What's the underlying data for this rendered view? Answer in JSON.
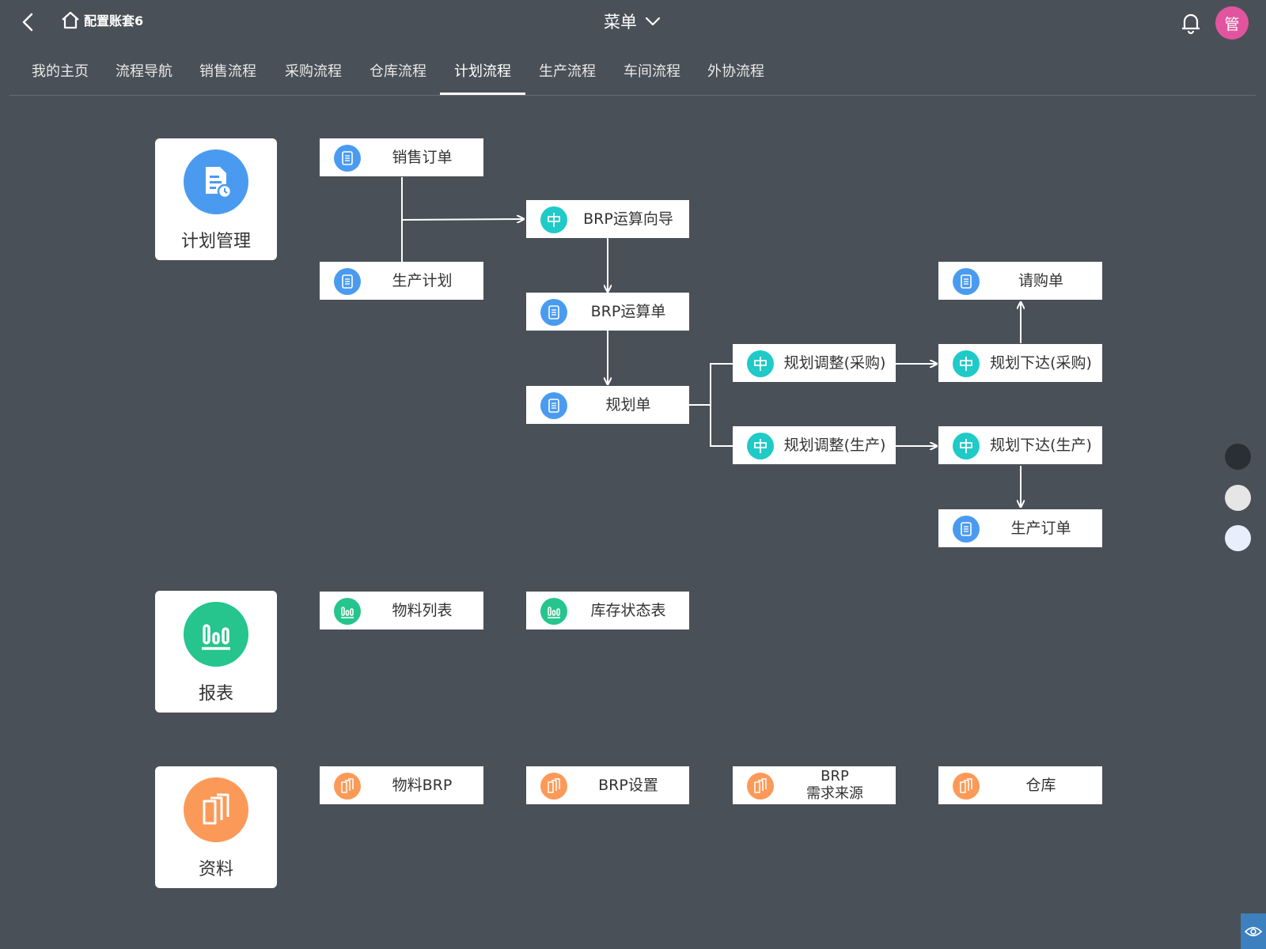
{
  "header": {
    "account_name": "配置账套6",
    "menu_label": "菜单",
    "avatar_text": "管",
    "icons": {
      "back": "chevron-left-icon",
      "home": "home-icon",
      "menu": "chevron-down-icon",
      "notifications": "bell-icon"
    }
  },
  "tabs": [
    {
      "label": "我的主页",
      "active": false
    },
    {
      "label": "流程导航",
      "active": false
    },
    {
      "label": "销售流程",
      "active": false
    },
    {
      "label": "采购流程",
      "active": false
    },
    {
      "label": "仓库流程",
      "active": false
    },
    {
      "label": "计划流程",
      "active": true
    },
    {
      "label": "生产流程",
      "active": false
    },
    {
      "label": "车间流程",
      "active": false
    },
    {
      "label": "外协流程",
      "active": false
    }
  ],
  "sections": {
    "plan": {
      "label": "计划管理",
      "icon": "document-clock-icon",
      "color": "#4a9bf0"
    },
    "report": {
      "label": "报表",
      "icon": "bar-chart-icon",
      "color": "#25c58d"
    },
    "data": {
      "label": "资料",
      "icon": "files-icon",
      "color": "#fb9a58"
    }
  },
  "flow_nodes": {
    "sales_order": {
      "label": "销售订单",
      "icon": "document-icon"
    },
    "production_plan": {
      "label": "生产计划",
      "icon": "document-icon"
    },
    "brp_wizard": {
      "label": "BRP运算向导",
      "icon": "signpost-icon"
    },
    "brp_calc": {
      "label": "BRP运算单",
      "icon": "document-icon"
    },
    "plan_sheet": {
      "label": "规划单",
      "icon": "document-icon"
    },
    "adjust_purchase": {
      "label": "规划调整(采购)",
      "icon": "signpost-icon"
    },
    "adjust_production": {
      "label": "规划调整(生产)",
      "icon": "signpost-icon"
    },
    "release_purchase": {
      "label": "规划下达(采购)",
      "icon": "signpost-icon"
    },
    "release_production": {
      "label": "规划下达(生产)",
      "icon": "signpost-icon"
    },
    "purchase_request": {
      "label": "请购单",
      "icon": "document-icon"
    },
    "production_order": {
      "label": "生产订单",
      "icon": "document-icon"
    }
  },
  "report_nodes": {
    "material_list": {
      "label": "物料列表",
      "icon": "bar-chart-icon"
    },
    "stock_status": {
      "label": "库存状态表",
      "icon": "bar-chart-icon"
    }
  },
  "data_nodes": {
    "material_brp": {
      "label": "物料BRP",
      "icon": "files-icon"
    },
    "brp_settings": {
      "label": "BRP设置",
      "icon": "files-icon"
    },
    "brp_demand_source": {
      "label_line1": "BRP",
      "label_line2": "需求来源",
      "icon": "files-icon"
    },
    "warehouse": {
      "label": "仓库",
      "icon": "files-icon"
    }
  },
  "theme": {
    "background": "#4a5057",
    "doc_blue": "#4a9bf0",
    "guide_teal": "#1fcac7",
    "report_green": "#25c58d",
    "data_orange": "#fb9a58",
    "avatar_pink": "#e0559e"
  },
  "side_dots": [
    "#2a2f36",
    "#e6e6e6",
    "#e8eefc"
  ],
  "corner_icon": "eye-icon"
}
